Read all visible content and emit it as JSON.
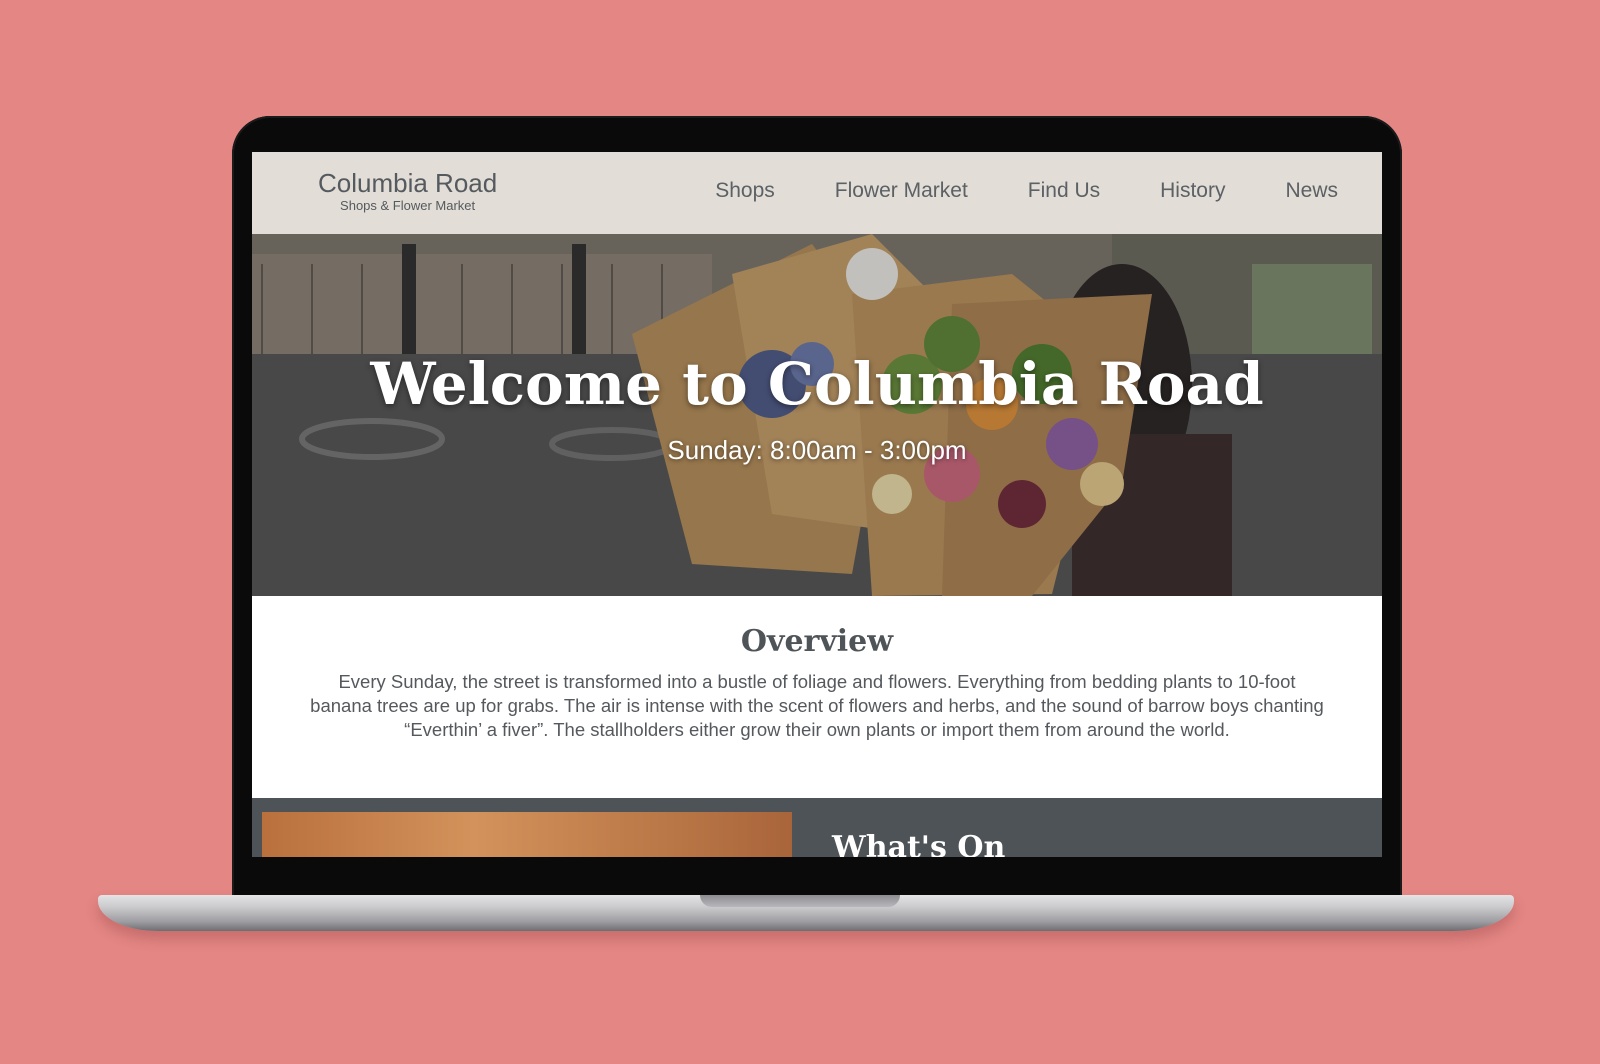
{
  "navbar": {
    "brand_title": "Columbia Road",
    "brand_subtitle": "Shops & Flower Market",
    "links": [
      "Shops",
      "Flower Market",
      "Find Us",
      "History",
      "News"
    ]
  },
  "hero": {
    "title": "Welcome to Columbia Road",
    "hours": "Sunday: 8:00am  - 3:00pm"
  },
  "overview": {
    "heading": "Overview",
    "text": "Every Sunday, the street is transformed into a bustle of foliage and flowers. Everything from bedding plants to 10-foot banana trees are up for grabs. The air is intense with the scent of flowers and herbs,  and the sound of barrow boys chanting “Everthin’ a fiver”.  The stallholders either grow their own plants or import them from around the world."
  },
  "next_section": {
    "title_partial": "What's On"
  },
  "colors": {
    "page_background": "#e38684",
    "navbar_background": "#e2ddd7",
    "section_dark": "#4e5357",
    "text_grey": "#55595d"
  }
}
